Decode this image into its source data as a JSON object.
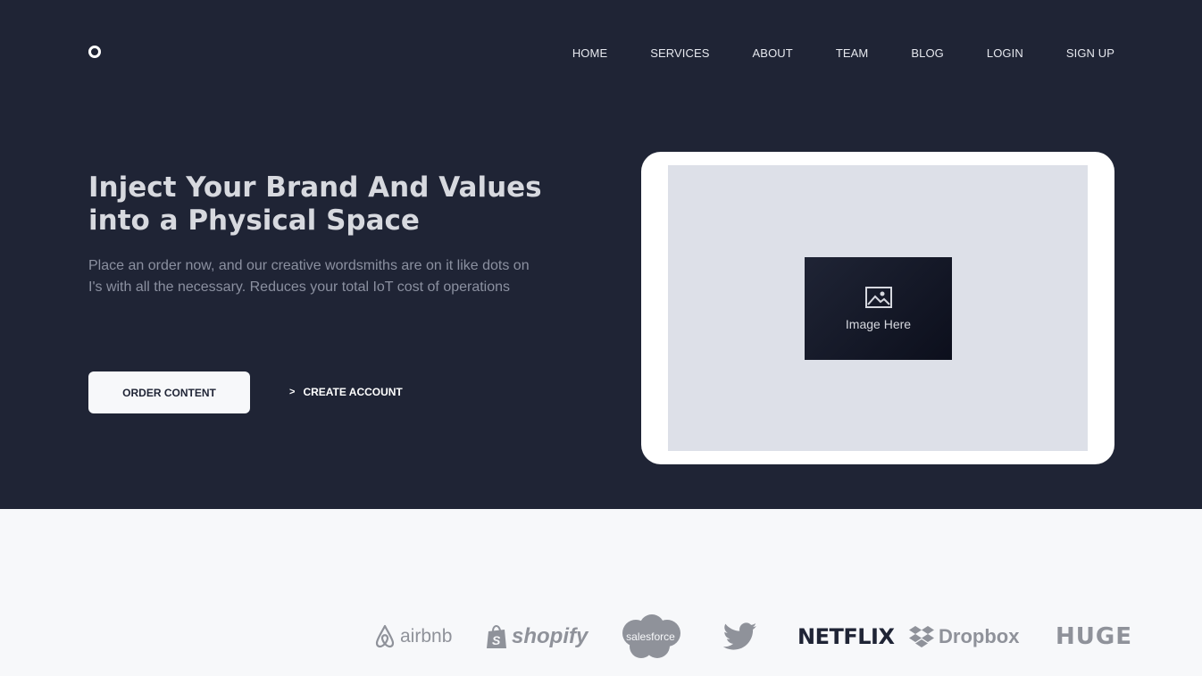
{
  "nav": {
    "items": [
      "HOME",
      "SERVICES",
      "ABOUT",
      "TEAM",
      "BLOG",
      "LOGIN",
      "SIGN UP"
    ]
  },
  "hero": {
    "headline": "Inject Your Brand And Values into a Physical Space",
    "subtext": "Place an order now, and our creative wordsmiths are on it like dots on I's with all the necessary. Reduces your total IoT cost of operations",
    "primary_button": "ORDER CONTENT",
    "secondary_link": "CREATE ACCOUNT",
    "secondary_chevron": ">",
    "image_placeholder": "Image Here"
  },
  "brands": {
    "airbnb": "airbnb",
    "shopify": "shopify",
    "salesforce": "salesforce",
    "netflix": "NETFLIX",
    "dropbox": "Dropbox",
    "huge": "HUGE"
  },
  "colors": {
    "hero_bg": "#1f2435",
    "section_bg": "#f7f8fa",
    "frame_inner": "#dde0e8",
    "logo_grey": "#8f929a"
  }
}
